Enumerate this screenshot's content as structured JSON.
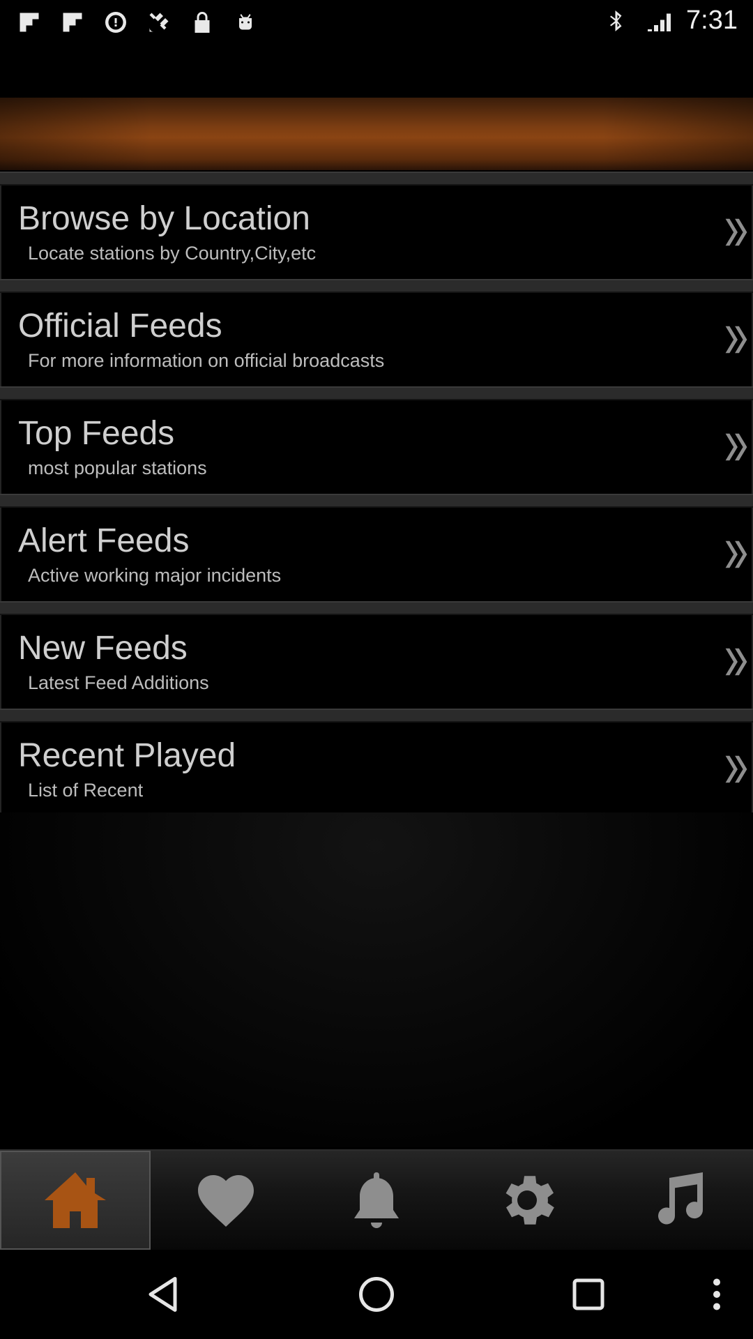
{
  "status_bar": {
    "time": "7:31",
    "left_icons": [
      "flipboard-icon",
      "flipboard-icon",
      "data-saver-icon",
      "satellite-icon",
      "lock-icon",
      "android-icon"
    ],
    "right_icons": [
      "bluetooth-icon"
    ]
  },
  "menu": {
    "items": [
      {
        "title": "Browse by Location",
        "subtitle": "Locate stations by Country,City,etc"
      },
      {
        "title": "Official Feeds",
        "subtitle": "For more information on official broadcasts"
      },
      {
        "title": "Top Feeds",
        "subtitle": "most popular stations"
      },
      {
        "title": "Alert Feeds",
        "subtitle": "Active working major incidents"
      },
      {
        "title": "New Feeds",
        "subtitle": "Latest Feed Additions"
      },
      {
        "title": "Recent Played",
        "subtitle": "List of Recent"
      }
    ]
  },
  "bottom_nav": {
    "tabs": [
      "home-icon",
      "heart-icon",
      "bell-icon",
      "gear-icon",
      "music-note-icon"
    ],
    "active_tab": "home-icon"
  },
  "colors": {
    "accent": "#a85414",
    "header_band": "#8a4413",
    "icon_gray": "#8e8e8e"
  }
}
